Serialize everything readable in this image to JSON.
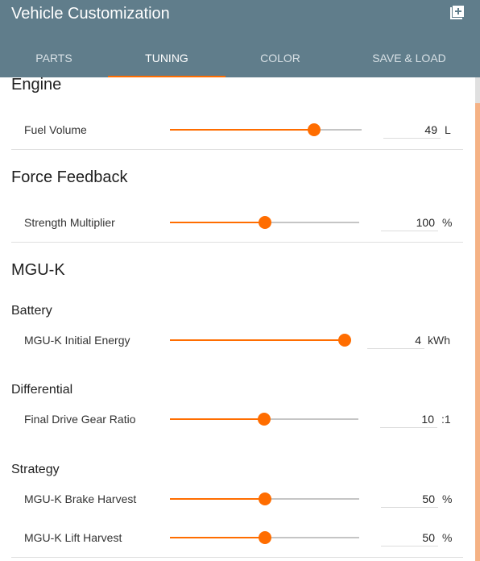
{
  "app": {
    "title": "Vehicle Customization",
    "add_icon": "add-box-icon"
  },
  "tabs": [
    {
      "label": "PARTS",
      "active": false
    },
    {
      "label": "TUNING",
      "active": true
    },
    {
      "label": "COLOR",
      "active": false
    },
    {
      "label": "SAVE & LOAD",
      "active": false
    }
  ],
  "colors": {
    "appbar": "#607d8b",
    "accent": "#ff6d00"
  },
  "sections": {
    "engine": {
      "title": "Engine",
      "fuel_volume": {
        "label": "Fuel Volume",
        "value": "49",
        "unit": "L",
        "slider_fraction": 0.75
      }
    },
    "force_feedback": {
      "title": "Force Feedback",
      "strength_multiplier": {
        "label": "Strength Multiplier",
        "value": "100",
        "unit": "%",
        "slider_fraction": 0.5
      }
    },
    "mguk": {
      "title": "MGU-K",
      "battery": {
        "title": "Battery",
        "initial_energy": {
          "label": "MGU-K Initial Energy",
          "value": "4",
          "unit": "kWh",
          "slider_fraction": 1.0
        }
      },
      "differential": {
        "title": "Differential",
        "final_drive": {
          "label": "Final Drive Gear Ratio",
          "value": "10",
          "unit": ":1",
          "slider_fraction": 0.5
        }
      },
      "strategy": {
        "title": "Strategy",
        "brake_harvest": {
          "label": "MGU-K Brake Harvest",
          "value": "50",
          "unit": "%",
          "slider_fraction": 0.5
        },
        "lift_harvest": {
          "label": "MGU-K Lift Harvest",
          "value": "50",
          "unit": "%",
          "slider_fraction": 0.5
        }
      }
    }
  }
}
